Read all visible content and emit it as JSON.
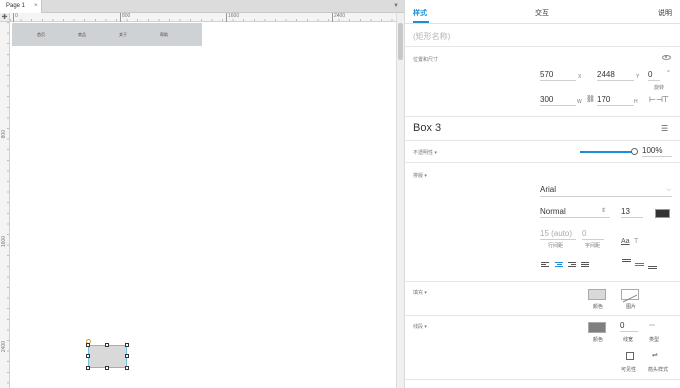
{
  "canvas": {
    "tab_label": "Page 1",
    "tab_close": "×",
    "ruler_corner": "✚",
    "ruler_h_ticks": [
      "0",
      "800",
      "1600",
      "2400"
    ],
    "ruler_v_ticks": [
      "800",
      "1600",
      "2400"
    ],
    "nav_items": [
      "首页",
      "商品",
      "关于",
      "帮助"
    ]
  },
  "panel": {
    "tabs": {
      "style": "样式",
      "interaction": "交互",
      "notes": "说明"
    },
    "name_placeholder": "(矩形名称)",
    "position_size": {
      "section_label": "位置和尺寸",
      "x": "570",
      "x_label": "X",
      "y": "2448",
      "y_label": "Y",
      "rotation": "0",
      "rotation_unit": "°",
      "rotation_label": "旋转",
      "w": "300",
      "w_label": "W",
      "h": "170",
      "h_label": "H"
    },
    "style_name": "Box 3",
    "opacity": {
      "label": "不透明性 ▾",
      "value": "100%",
      "level": 1.0
    },
    "typography": {
      "label": "排版 ▾",
      "font_family": "Arial",
      "font_weight": "Normal",
      "font_size": "13",
      "color": "#333333",
      "line_spacing": "15 (auto)",
      "line_spacing_label": "行间距",
      "char_spacing": "0",
      "char_spacing_label": "字间距"
    },
    "fill": {
      "label": "填充 ▾",
      "color_label": "颜色",
      "image_label": "图片",
      "color": "#d9d9d9"
    },
    "border": {
      "label": "线段 ▾",
      "color_label": "颜色",
      "width": "0",
      "width_label": "线宽",
      "type_label": "类型",
      "visibility_label": "可见性",
      "arrow_label": "箭头样式",
      "color": "#7f7f7f"
    }
  }
}
